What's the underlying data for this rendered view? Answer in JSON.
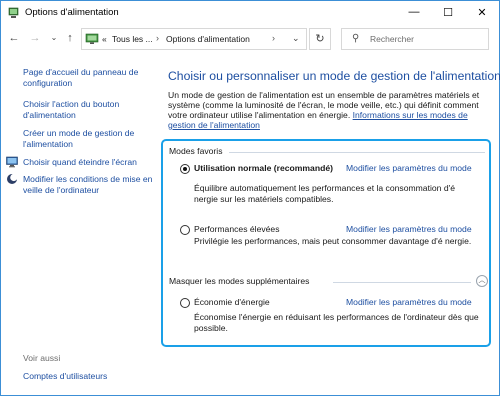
{
  "window": {
    "title": "Options d'alimentation",
    "minimize_glyph": "—",
    "maximize_glyph": "☐",
    "close_glyph": "✕"
  },
  "address_bar": {
    "overflow": "«",
    "segments": [
      "Tous les ...",
      "Options d'alimentation"
    ],
    "separator": "›",
    "search_placeholder": "Rechercher"
  },
  "sidebar": {
    "links": [
      {
        "label": "Page d'accueil du panneau de configuration",
        "icon": null
      },
      {
        "label": "Choisir l'action du bouton d'alimentation",
        "icon": null
      },
      {
        "label": "Créer un mode de gestion de l'alimentation",
        "icon": null
      },
      {
        "label": "Choisir quand éteindre l'écran",
        "icon": "monitor-icon"
      },
      {
        "label": "Modifier les conditions de mise en veille de l'ordinateur",
        "icon": "moon-icon"
      }
    ],
    "see_also_title": "Voir aussi",
    "see_also_links": [
      "Comptes d'utilisateurs"
    ]
  },
  "main": {
    "title": "Choisir ou personnaliser un mode de gestion de l'alimentation",
    "intro_text": "Un mode de gestion de l'alimentation est un ensemble de paramètres matériels et système (comme la luminosité de l'écran, le mode veille, etc.) qui définit comment votre ordinateur utilise l'alimentation en énergie.",
    "intro_link": "Informations sur les modes de gestion de l'alimentation",
    "favorites_label": "Modes favoris",
    "hidden_label": "Masquer les modes supplémentaires",
    "edit_label": "Modifier les paramètres du mode",
    "plans": [
      {
        "name": "Utilisation normale (recommandé)",
        "selected": true,
        "description": "Équilibre automatiquement les performances et la consommation d'é nergie sur les matériels compatibles."
      },
      {
        "name": "Performances élevées",
        "selected": false,
        "description": "Privilégie les performances, mais peut consommer davantage d'é nergie."
      },
      {
        "name": "Économie d'énergie",
        "selected": false,
        "description": "Économise l'énergie en réduisant les performances de l'ordinateur dès que possible."
      }
    ]
  },
  "colors": {
    "accent_border": "#1aa0e8",
    "link": "#1e4fa1",
    "window_border": "#3c8fd6"
  }
}
